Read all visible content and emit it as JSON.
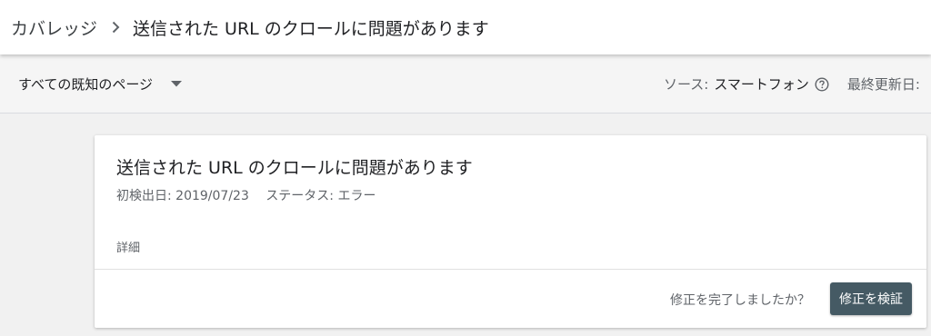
{
  "breadcrumb": {
    "root": "カバレッジ",
    "current": "送信された URL のクロールに問題があります"
  },
  "filter": {
    "selected": "すべての既知のページ",
    "source_label": "ソース:",
    "source_value": "スマートフォン",
    "updated_label": "最終更新日:"
  },
  "card": {
    "title": "送信された URL のクロールに問題があります",
    "first_detected": "初検出日: 2019/07/23",
    "status": "ステータス: エラー",
    "details_label": "詳細",
    "fix_question": "修正を完了しましたか？",
    "validate_button": "修正を検証"
  },
  "colors": {
    "header_bg": "#ffffff",
    "page_bg": "#f1f1f1",
    "button_bg": "#455a64",
    "primary_text": "#202124",
    "secondary_text": "#5f6368"
  },
  "icons": {
    "breadcrumb_separator": "chevron-right-icon",
    "dropdown": "caret-down-icon",
    "help": "help-circle-icon"
  }
}
